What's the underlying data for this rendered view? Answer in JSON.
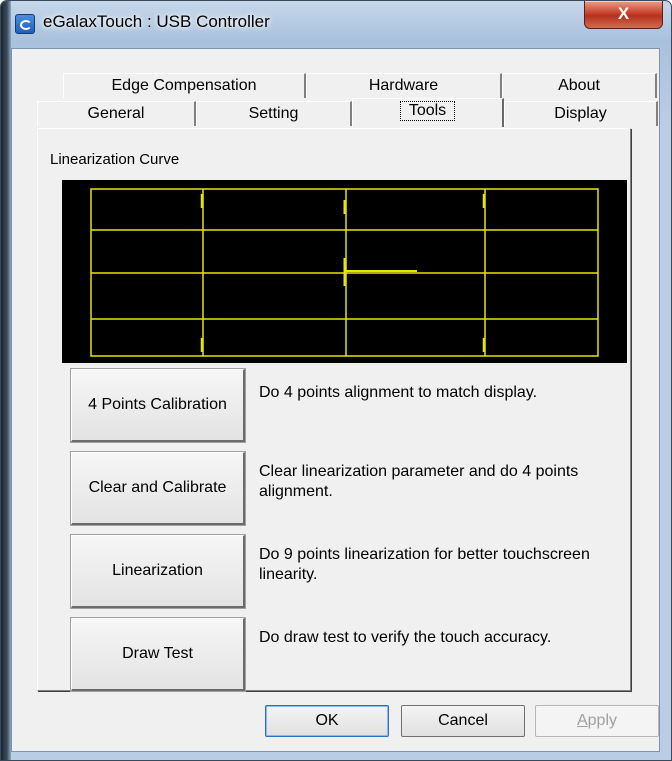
{
  "window": {
    "title": "eGalaxTouch : USB Controller",
    "close_label": "X"
  },
  "tabs": {
    "back_row": [
      "Edge Compensation",
      "Hardware",
      "About"
    ],
    "front_row": [
      "General",
      "Setting",
      "Tools",
      "Display"
    ],
    "selected": "Tools"
  },
  "tools": {
    "curve_label": "Linearization Curve",
    "curve_color": "#e6e600",
    "actions": [
      {
        "button": "4 Points Calibration",
        "description": "Do 4 points alignment to match display."
      },
      {
        "button": "Clear and Calibrate",
        "description": "Clear linearization parameter and do 4 points alignment."
      },
      {
        "button": "Linearization",
        "description": "Do 9 points linearization for better touchscreen linearity."
      },
      {
        "button": "Draw Test",
        "description": "Do draw test to verify the touch accuracy."
      }
    ]
  },
  "footer": {
    "ok_label": "OK",
    "cancel_label": "Cancel",
    "apply_label": "Apply",
    "apply_accel": "A",
    "apply_rest": "pply",
    "apply_enabled": false
  }
}
